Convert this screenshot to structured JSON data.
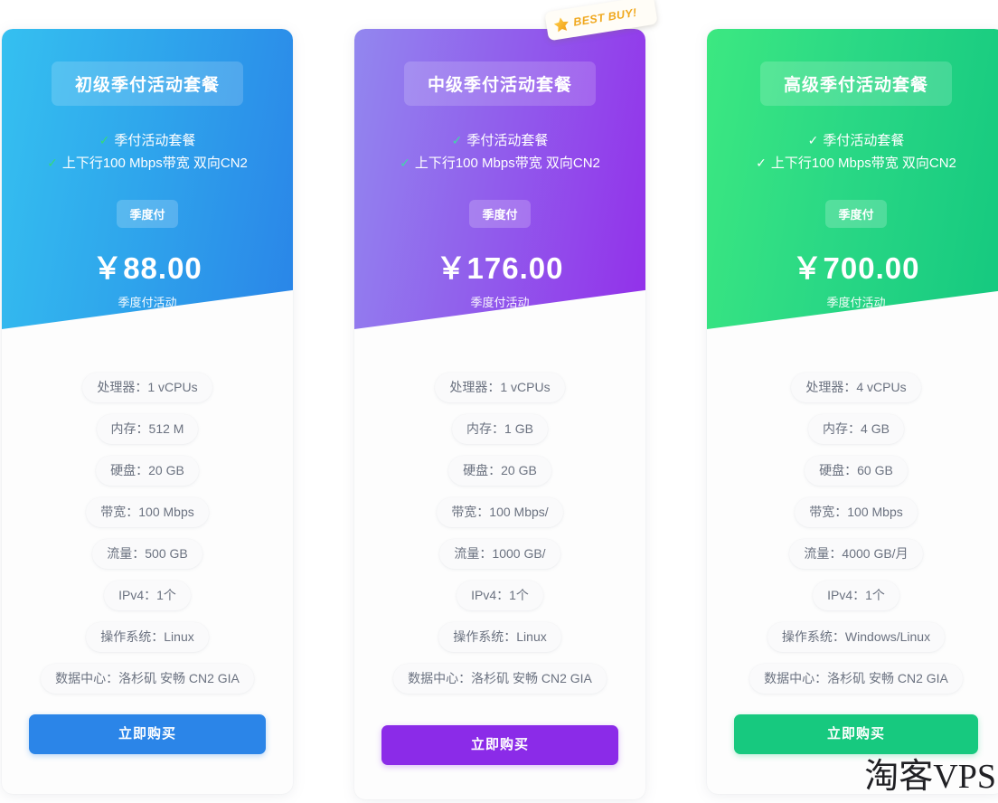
{
  "watermark": "淘客VPS",
  "badge": {
    "label": "BEST BUY!",
    "icon": "star-icon",
    "color": "#f0a81e"
  },
  "theme": {
    "blue_from": "#35c0f0",
    "blue_to": "#2a85e8",
    "blue_button": "#2b85e8",
    "purple_from": "#9287ef",
    "purple_to": "#9230ea",
    "purple_button": "#8b2be8",
    "green_from": "#3ce881",
    "green_to": "#14c87f",
    "green_button": "#17c97f",
    "check_color": "#35d97a"
  },
  "cards": [
    {
      "id": "basic",
      "title": "初级季付活动套餐",
      "features": [
        "季付活动套餐",
        "上下行100 Mbps带宽 双向CN2"
      ],
      "term": "季度付",
      "price": "￥88.00",
      "price_note": "季度付活动",
      "specs": [
        "处理器：1 vCPUs",
        "内存：512 M",
        "硬盘：20 GB",
        "带宽：100 Mbps",
        "流量：500 GB",
        "IPv4：1个",
        "操作系统：Linux",
        "数据中心：洛杉矶 安畅 CN2 GIA"
      ],
      "cta": "立即购买"
    },
    {
      "id": "standard",
      "title": "中级季付活动套餐",
      "features": [
        "季付活动套餐",
        "上下行100 Mbps带宽 双向CN2"
      ],
      "term": "季度付",
      "price": "￥176.00",
      "price_note": "季度付活动",
      "specs": [
        "处理器：1 vCPUs",
        "内存：1 GB",
        "硬盘：20 GB",
        "带宽：100 Mbps/",
        "流量：1000 GB/",
        "IPv4：1个",
        "操作系统：Linux",
        "数据中心：洛杉矶 安畅 CN2 GIA"
      ],
      "cta": "立即购买"
    },
    {
      "id": "premium",
      "title": "高级季付活动套餐",
      "features": [
        "季付活动套餐",
        "上下行100 Mbps带宽 双向CN2"
      ],
      "term": "季度付",
      "price": "￥700.00",
      "price_note": "季度付活动",
      "specs": [
        "处理器：4 vCPUs",
        "内存：4 GB",
        "硬盘：60 GB",
        "带宽：100 Mbps",
        "流量：4000 GB/月",
        "IPv4：1个",
        "操作系统：Windows/Linux",
        "数据中心：洛杉矶 安畅 CN2 GIA"
      ],
      "cta": "立即购买"
    }
  ]
}
